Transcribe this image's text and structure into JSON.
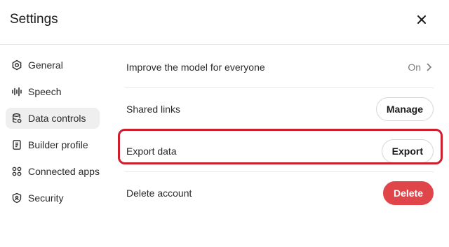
{
  "header": {
    "title": "Settings",
    "close_icon": "close-icon"
  },
  "sidebar": {
    "items": [
      {
        "label": "General",
        "icon": "gear-icon",
        "active": false
      },
      {
        "label": "Speech",
        "icon": "waveform-icon",
        "active": false
      },
      {
        "label": "Data controls",
        "icon": "database-icon",
        "active": true
      },
      {
        "label": "Builder profile",
        "icon": "id-card-icon",
        "active": false
      },
      {
        "label": "Connected apps",
        "icon": "apps-grid-icon",
        "active": false
      },
      {
        "label": "Security",
        "icon": "shield-icon",
        "active": false
      }
    ]
  },
  "main": {
    "rows": [
      {
        "label": "Improve the model for everyone",
        "value": "On"
      },
      {
        "label": "Shared links",
        "button": "Manage"
      },
      {
        "label": "Export data",
        "button": "Export",
        "highlighted": true
      },
      {
        "label": "Delete account",
        "button": "Delete"
      }
    ]
  },
  "colors": {
    "highlight": "#cc1f2d",
    "danger": "#e0454a",
    "active_bg": "#efefef"
  }
}
